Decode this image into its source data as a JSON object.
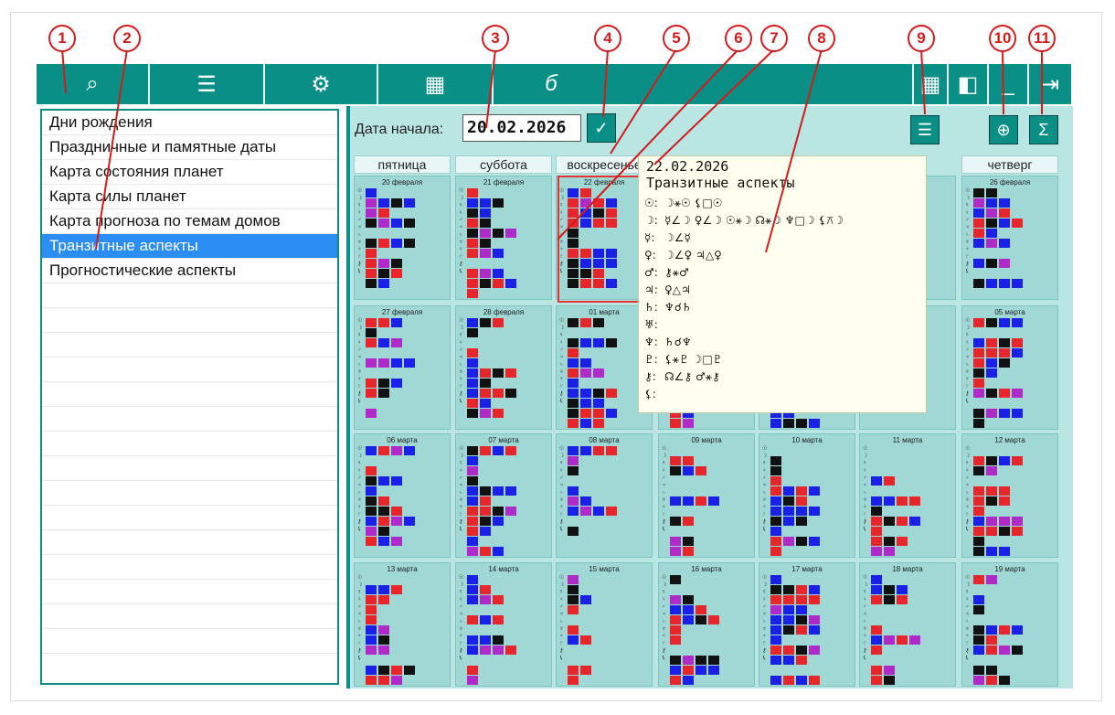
{
  "toolbar": {
    "buttons": [
      {
        "name": "search-data-icon",
        "glyph": "⌕"
      },
      {
        "name": "list-icon",
        "glyph": "☰"
      },
      {
        "name": "gear-icon",
        "glyph": "⚙"
      },
      {
        "name": "calculator-icon",
        "glyph": "▦"
      },
      {
        "name": "logo-icon",
        "glyph": "б"
      }
    ],
    "right_buttons": [
      {
        "name": "grid-view-icon",
        "glyph": "▦"
      },
      {
        "name": "split-view-icon",
        "glyph": "◧"
      },
      {
        "name": "minimize-icon",
        "glyph": "_"
      },
      {
        "name": "exit-icon",
        "glyph": "⇥"
      }
    ]
  },
  "sidebar": {
    "items": [
      {
        "label": "Дни рождения",
        "selected": false
      },
      {
        "label": "Праздничные и памятные даты",
        "selected": false
      },
      {
        "label": "Карта состояния планет",
        "selected": false
      },
      {
        "label": "Карта силы планет",
        "selected": false
      },
      {
        "label": "Карта прогноза по темам домов",
        "selected": false
      },
      {
        "label": "Транзитные аспекты",
        "selected": true
      },
      {
        "label": "Прогностические аспекты",
        "selected": false
      }
    ]
  },
  "main": {
    "date_label": "Дата начала:",
    "date_value": "20.02.2026",
    "weekdays": [
      "пятница",
      "суббота",
      "воскресенье",
      "",
      "",
      "",
      "четверг"
    ],
    "weeks": [
      [
        "20 февраля",
        "21 февраля",
        "22 февраля",
        "",
        "",
        "",
        "26 февраля"
      ],
      [
        "27 февраля",
        "28 февраля",
        "01 марта",
        "",
        "",
        "",
        "05 марта"
      ],
      [
        "06 марта",
        "07 марта",
        "08 марта",
        "09 марта",
        "10 марта",
        "11 марта",
        "12 марта"
      ],
      [
        "13 марта",
        "14 марта",
        "15 марта",
        "16 марта",
        "17 марта",
        "18 марта",
        "19 марта"
      ]
    ]
  },
  "tooltip": {
    "date": "22.02.2026",
    "title": "Транзитные аспекты",
    "rows": [
      {
        "planet": "☉:",
        "aspects": "☽⚹☉  ⚸□☉"
      },
      {
        "planet": "☽:",
        "aspects": "☿∠☽  ♀∠☽  ☉⚹☽  ☊⚹☽  ♆□☽  ⚸⚻☽"
      },
      {
        "planet": "☿:",
        "aspects": "☽∠☿"
      },
      {
        "planet": "♀:",
        "aspects": "☽∠♀  ♃△♀"
      },
      {
        "planet": "♂:",
        "aspects": "⚷⚹♂"
      },
      {
        "planet": "♃:",
        "aspects": "♀△♃"
      },
      {
        "planet": "♄:",
        "aspects": "♆☌♄"
      },
      {
        "planet": "♅:",
        "aspects": ""
      },
      {
        "planet": "♆:",
        "aspects": "♄☌♆"
      },
      {
        "planet": "♇:",
        "aspects": "⚸⚹♇  ☽□♇"
      },
      {
        "planet": "⚷:",
        "aspects": "☊∠⚷  ♂⚹⚷"
      },
      {
        "planet": "⚸:",
        "aspects": ""
      }
    ]
  },
  "callouts": [
    "1",
    "2",
    "3",
    "4",
    "5",
    "6",
    "7",
    "8",
    "9",
    "10",
    "11"
  ],
  "planet_column": "☉☽☿♀♂♃♄♅♆♇⚷⚸"
}
